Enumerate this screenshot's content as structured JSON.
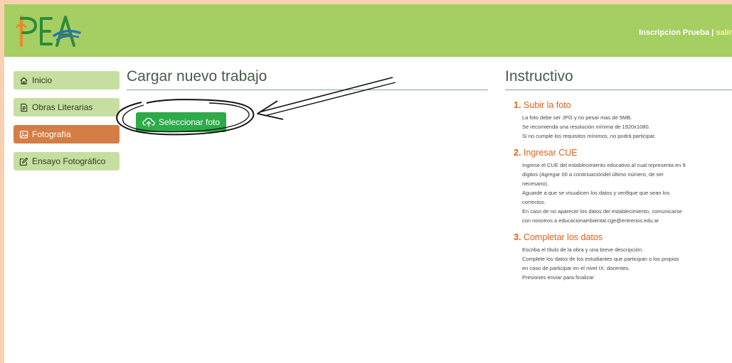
{
  "header": {
    "logo_text": "PEA",
    "user": "Inscripcion Prueba",
    "separator": " | ",
    "logout": "salir"
  },
  "sidebar": {
    "items": [
      {
        "label": "Inicio",
        "icon": "home-icon"
      },
      {
        "label": "Obras Literarias",
        "icon": "document-icon"
      },
      {
        "label": "Fotografía",
        "icon": "image-icon",
        "active": true
      },
      {
        "label": "Ensayo Fotográfico",
        "icon": "edit-icon"
      }
    ]
  },
  "main": {
    "title": "Cargar nuevo trabajo",
    "upload_label": "Seleccionar foto"
  },
  "instructions": {
    "title": "Instructivo",
    "steps": [
      {
        "number": "1.",
        "heading": "Subir la foto",
        "lines": [
          "La foto debe ser JPG y no pesar mas de 5MB.",
          "Se recomienda una resolución mínima de 1920x1080.",
          "Si no cumple los requisitos mínimos, no podrá participar."
        ]
      },
      {
        "number": "2.",
        "heading": "Ingresar CUE",
        "lines": [
          "Ingrese el CUE del establecimiento educativo al cual representa en 9",
          "dígitos (Agregar 00 a continuacióndel último número, de ser",
          "necesario).",
          "Aguarde a que se visualicen los datos y verifique que sean los",
          "correctos.",
          "En caso de no aparecer los datos del establecimiento, comunicarse",
          "con nosotros a educacionambiental.cge@entrerios.edu.ar"
        ]
      },
      {
        "number": "3.",
        "heading": "Completar los datos",
        "lines": [
          "Escriba el título de la obra y una breve descripción.",
          "Complete los datos de los estudiantes que participan o los propios",
          "en caso de participar en el nivel IX: docentes.",
          "Presiones enviar para finalizar"
        ]
      }
    ]
  },
  "colors": {
    "header_bg": "#a5cf63",
    "sidebar_item": "#c6dfa1",
    "sidebar_active": "#d47d45",
    "upload_button": "#2eaa4a",
    "step_heading": "#e0601c",
    "page_border": "#f7d1b0"
  }
}
